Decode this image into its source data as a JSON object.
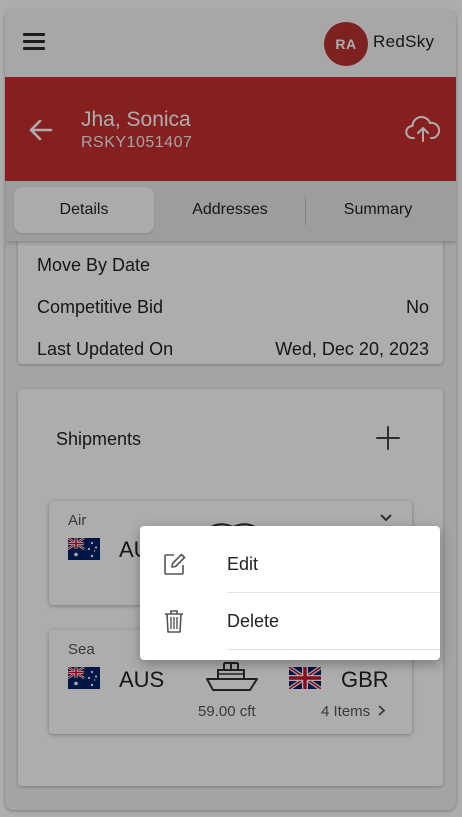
{
  "app": {
    "brand": "RedSky",
    "avatar_initials": "RA",
    "brand_color": "#b83232",
    "header_color": "#c62f2f"
  },
  "header": {
    "name": "Jha, Sonica",
    "id": "RSKY1051407"
  },
  "tabs": [
    {
      "label": "Details",
      "active": true
    },
    {
      "label": "Addresses",
      "active": false
    },
    {
      "label": "Summary",
      "active": false
    }
  ],
  "details": {
    "rows": [
      {
        "label": "Move By Date",
        "value": ""
      },
      {
        "label": "Competitive Bid",
        "value": "No"
      },
      {
        "label": "Last Updated On",
        "value": "Wed, Dec 20, 2023"
      }
    ]
  },
  "shipments": {
    "title": "Shipments",
    "items": [
      {
        "mode": "Air",
        "origin": "AU",
        "origin_flag": "AUS",
        "transport_icon": "plane-icon"
      },
      {
        "mode": "Sea",
        "origin": "AUS",
        "destination": "GBR",
        "origin_flag": "AUS",
        "destination_flag": "GBR",
        "measure": "59.00 cft",
        "items": "4 Items",
        "transport_icon": "ship-icon"
      }
    ]
  },
  "context_menu": {
    "items": [
      {
        "label": "Edit",
        "icon": "edit-icon"
      },
      {
        "label": "Delete",
        "icon": "trash-icon"
      }
    ]
  }
}
